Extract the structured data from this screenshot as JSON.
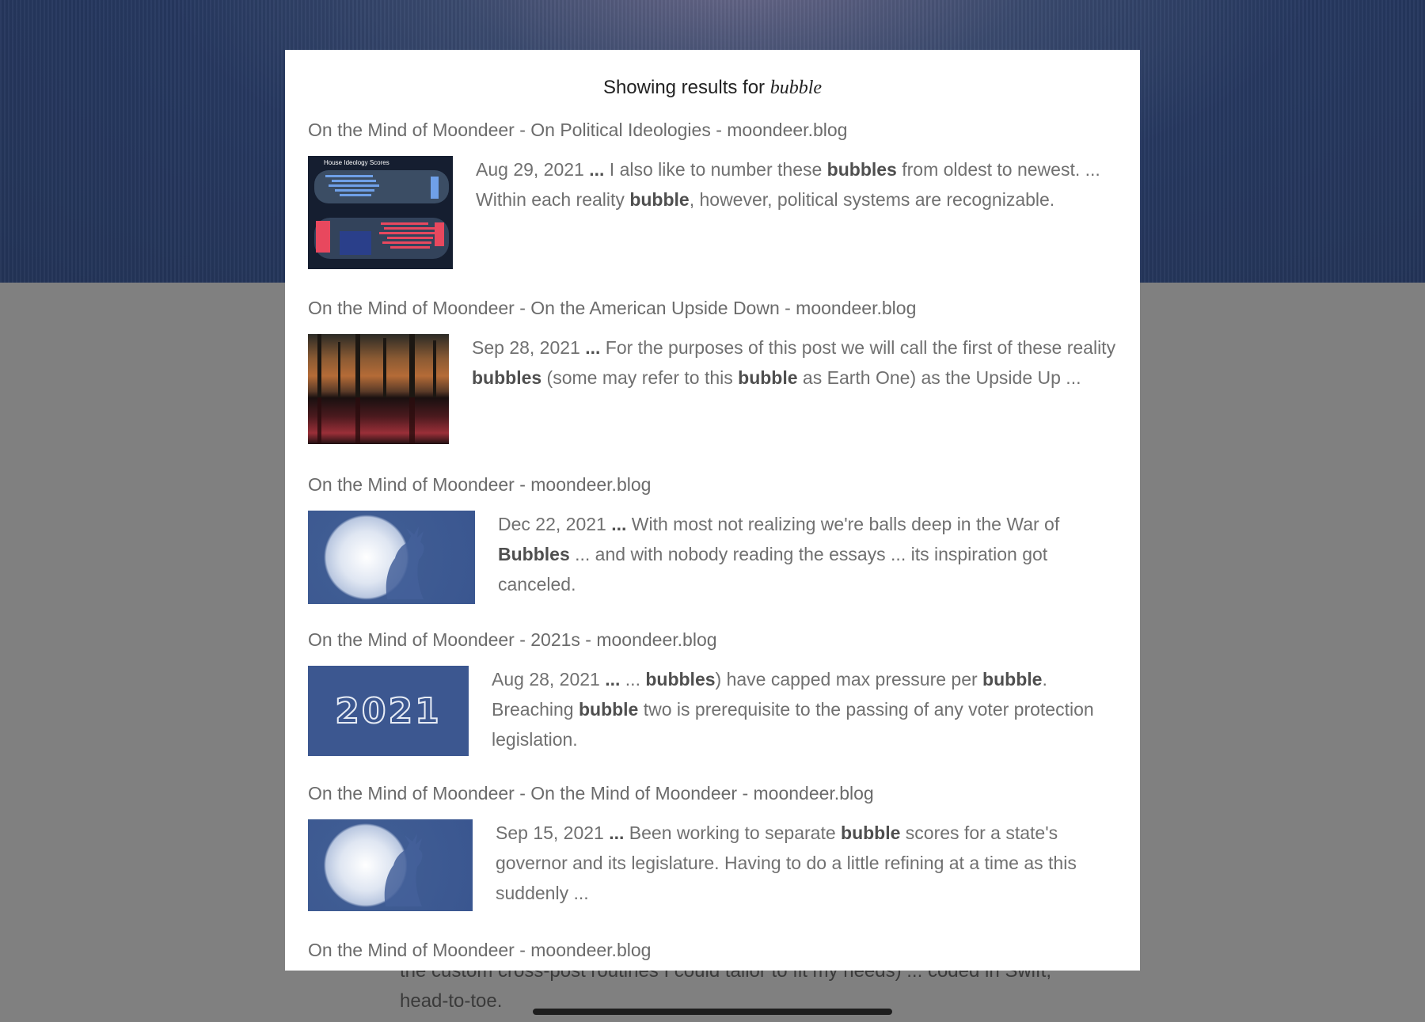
{
  "header": {
    "prefix": "Showing results for ",
    "query": "bubble"
  },
  "results": [
    {
      "title": "On the Mind of Moondeer - On Political Ideologies - moondeer.blog",
      "thumb_label": "House Ideology Scores",
      "snippet": [
        {
          "t": "Aug 29, 2021 ",
          "b": false
        },
        {
          "t": "...",
          "b": true
        },
        {
          "t": " I also like to number these ",
          "b": false
        },
        {
          "t": "bubbles",
          "b": true
        },
        {
          "t": " from oldest to newest. ... Within each reality ",
          "b": false
        },
        {
          "t": "bubble",
          "b": true
        },
        {
          "t": ", however, political systems are recognizable.",
          "b": false
        }
      ]
    },
    {
      "title": "On the Mind of Moondeer - On the American Upside Down - moondeer.blog",
      "snippet": [
        {
          "t": "Sep 28, 2021 ",
          "b": false
        },
        {
          "t": "...",
          "b": true
        },
        {
          "t": " For the purposes of this post we will call the first of these reality ",
          "b": false
        },
        {
          "t": "bubbles",
          "b": true
        },
        {
          "t": " (some may refer to this ",
          "b": false
        },
        {
          "t": "bubble",
          "b": true
        },
        {
          "t": " as Earth One) as the Upside Up ...",
          "b": false
        }
      ]
    },
    {
      "title": "On the Mind of Moondeer - moondeer.blog",
      "snippet": [
        {
          "t": "Dec 22, 2021 ",
          "b": false
        },
        {
          "t": "...",
          "b": true
        },
        {
          "t": " With most not realizing we're balls deep in the War of ",
          "b": false
        },
        {
          "t": "Bubbles",
          "b": true
        },
        {
          "t": " ... and with nobody reading the essays ... its inspiration got canceled.",
          "b": false
        }
      ]
    },
    {
      "title": "On the Mind of Moondeer - 2021s - moondeer.blog",
      "thumb_label": "2021",
      "snippet": [
        {
          "t": "Aug 28, 2021 ",
          "b": false
        },
        {
          "t": "...",
          "b": true
        },
        {
          "t": " ... ",
          "b": false
        },
        {
          "t": "bubbles",
          "b": true
        },
        {
          "t": ") have capped max pressure per ",
          "b": false
        },
        {
          "t": "bubble",
          "b": true
        },
        {
          "t": ". Breaching ",
          "b": false
        },
        {
          "t": "bubble",
          "b": true
        },
        {
          "t": " two is prerequisite to the passing of any voter protection legislation.",
          "b": false
        }
      ]
    },
    {
      "title": "On the Mind of Moondeer - On the Mind of Moondeer - moondeer.blog",
      "snippet": [
        {
          "t": "Sep 15, 2021 ",
          "b": false
        },
        {
          "t": "...",
          "b": true
        },
        {
          "t": " Been working to separate ",
          "b": false
        },
        {
          "t": "bubble",
          "b": true
        },
        {
          "t": " scores for a state's governor and its legislature. Having to do a little refining at a time as this suddenly ...",
          "b": false
        }
      ]
    },
    {
      "title": "On the Mind of Moondeer - moondeer.blog"
    }
  ],
  "underlying_page": {
    "text": "the custom cross-post routines I could tailor to fit my needs) ... coded in Swift, head-to-toe."
  },
  "colors": {
    "background_top": "#263860",
    "overlay": "#808080",
    "modal": "#ffffff",
    "thumb_blue": "#3c5790"
  }
}
